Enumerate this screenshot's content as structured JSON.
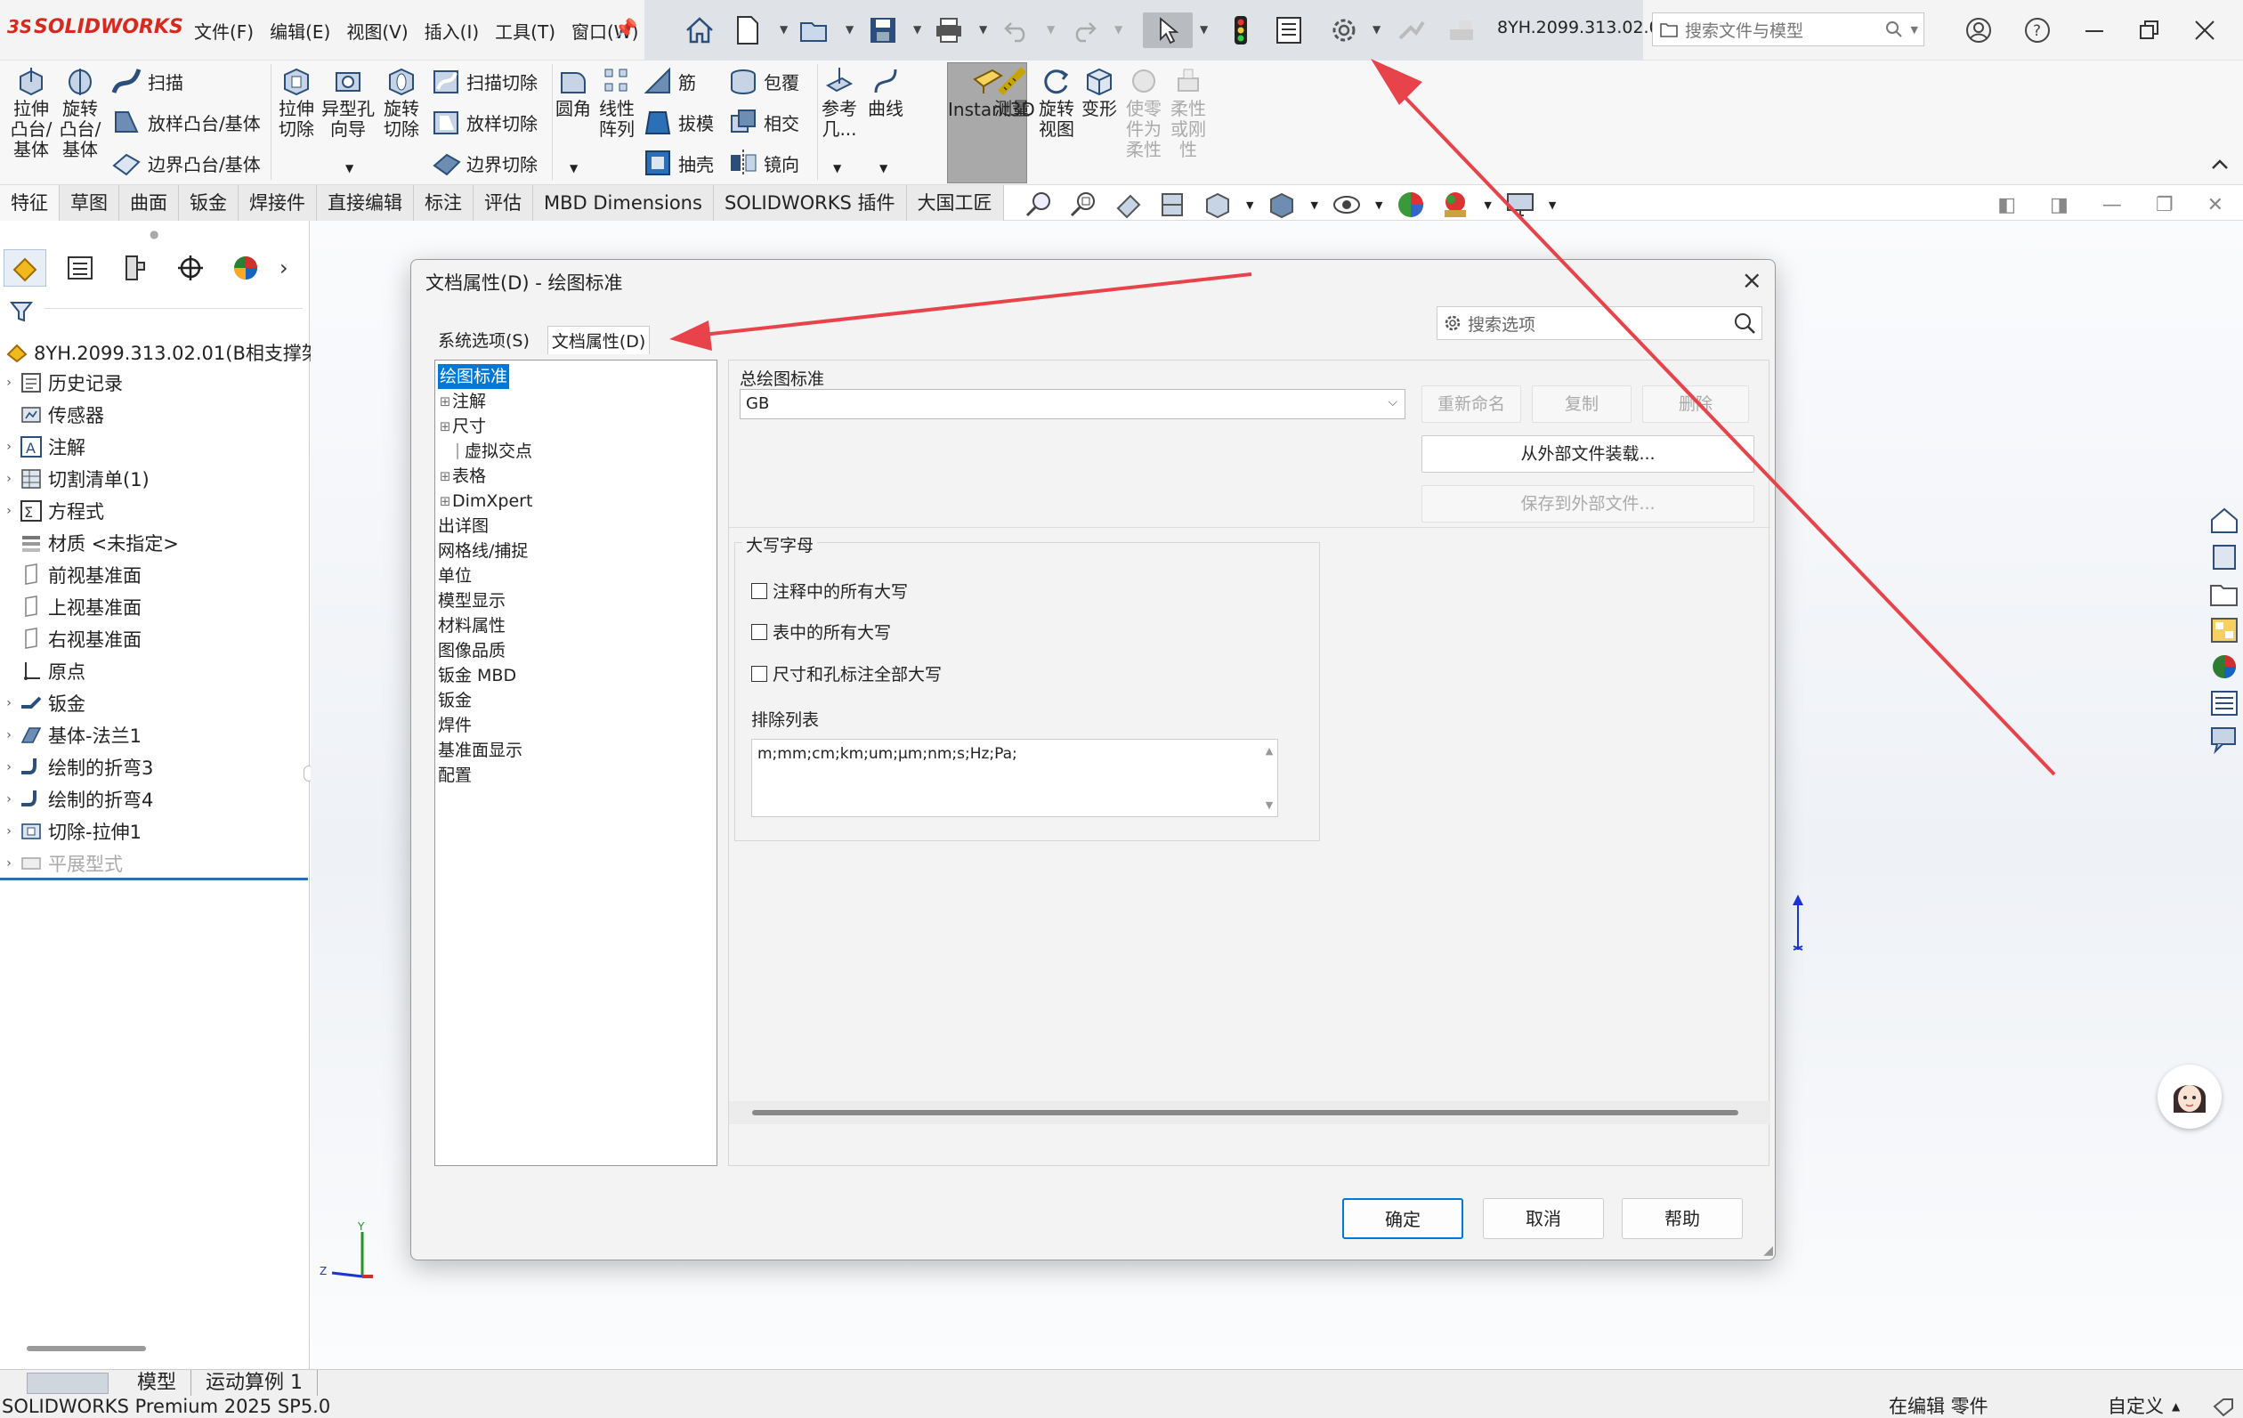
{
  "app": {
    "brand": "SOLIDWORKS",
    "menus": [
      "文件(F)",
      "编辑(E)",
      "视图(V)",
      "插入(I)",
      "工具(T)",
      "窗口(W)"
    ],
    "document_title": "8YH.2099.313.02.0...",
    "search_placeholder": "搜索文件与模型"
  },
  "command_manager": {
    "extrude_boss": "拉伸\n凸台/\n基体",
    "revolve_boss": "旋转\n凸台/\n基体",
    "sweep": "扫描",
    "loft_boss": "放样凸台/基体",
    "boundary_boss": "边界凸台/基体",
    "extrude_cut": "拉伸\n切除",
    "hole_wizard": "异型孔\n向导",
    "revolve_cut": "旋转\n切除",
    "swept_cut": "扫描切除",
    "lofted_cut": "放样切除",
    "boundary_cut": "边界切除",
    "fillet": "圆角",
    "linear_pattern": "线性\n阵列",
    "rib": "筋",
    "draft": "拔模",
    "shell": "抽壳",
    "wrap": "包覆",
    "intersect": "相交",
    "mirror": "镜向",
    "reference_geometry": "参考\n几...",
    "curves": "曲线",
    "instant3d": "Instant3D",
    "measure": "测量",
    "rotate_view": "旋转\n视图",
    "deform": "变形",
    "make_flexible": "使零\n件为\n柔性",
    "flexible_rigid": "柔性\n或刚\n性"
  },
  "tabs": [
    "特征",
    "草图",
    "曲面",
    "钣金",
    "焊接件",
    "直接编辑",
    "标注",
    "评估",
    "MBD Dimensions",
    "SOLIDWORKS 插件",
    "大国工匠"
  ],
  "feature_tree": {
    "root": "8YH.2099.313.02.01(B相支撑架",
    "items": [
      {
        "label": "历史记录",
        "expand": true,
        "icon": "history-icon"
      },
      {
        "label": "传感器",
        "expand": false,
        "icon": "sensor-icon"
      },
      {
        "label": "注解",
        "expand": true,
        "icon": "annotation-icon"
      },
      {
        "label": "切割清单(1)",
        "expand": true,
        "icon": "cutlist-icon"
      },
      {
        "label": "方程式",
        "expand": true,
        "icon": "equation-icon"
      },
      {
        "label": "材质 <未指定>",
        "expand": false,
        "icon": "material-icon"
      },
      {
        "label": "前视基准面",
        "expand": false,
        "icon": "plane-icon"
      },
      {
        "label": "上视基准面",
        "expand": false,
        "icon": "plane-icon"
      },
      {
        "label": "右视基准面",
        "expand": false,
        "icon": "plane-icon"
      },
      {
        "label": "原点",
        "expand": false,
        "icon": "origin-icon"
      },
      {
        "label": "钣金",
        "expand": true,
        "icon": "sheetmetal-icon"
      },
      {
        "label": "基体-法兰1",
        "expand": true,
        "icon": "base-flange-icon"
      },
      {
        "label": "绘制的折弯3",
        "expand": true,
        "icon": "sketched-bend-icon"
      },
      {
        "label": "绘制的折弯4",
        "expand": true,
        "icon": "sketched-bend-icon"
      },
      {
        "label": "切除-拉伸1",
        "expand": true,
        "icon": "cut-extrude-icon"
      },
      {
        "label": "平展型式",
        "expand": true,
        "icon": "flat-pattern-icon",
        "disabled": true
      }
    ]
  },
  "bottom_tabs": [
    "模型",
    "运动算例 1"
  ],
  "status": {
    "version": "SOLIDWORKS Premium 2025 SP5.0",
    "mode": "在编辑 零件",
    "custom": "自定义"
  },
  "dialog": {
    "title": "文档属性(D) - 绘图标准",
    "tabs": [
      "系统选项(S)",
      "文档属性(D)"
    ],
    "search_placeholder": "搜索选项",
    "tree": [
      {
        "label": "绘图标准",
        "selected": true,
        "level": 0,
        "expand": false
      },
      {
        "label": "注解",
        "level": 0,
        "expand": true
      },
      {
        "label": "尺寸",
        "level": 0,
        "expand": true
      },
      {
        "label": "虚拟交点",
        "level": 1,
        "expand": false
      },
      {
        "label": "表格",
        "level": 0,
        "expand": true
      },
      {
        "label": "DimXpert",
        "level": 0,
        "expand": true
      },
      {
        "label": "出详图",
        "level": 0,
        "expand": false
      },
      {
        "label": "网格线/捕捉",
        "level": 0,
        "expand": false
      },
      {
        "label": "单位",
        "level": 0,
        "expand": false
      },
      {
        "label": "模型显示",
        "level": 0,
        "expand": false
      },
      {
        "label": "材料属性",
        "level": 0,
        "expand": false
      },
      {
        "label": "图像品质",
        "level": 0,
        "expand": false
      },
      {
        "label": "钣金 MBD",
        "level": 0,
        "expand": false
      },
      {
        "label": "钣金",
        "level": 0,
        "expand": false
      },
      {
        "label": "焊件",
        "level": 0,
        "expand": false
      },
      {
        "label": "基准面显示",
        "level": 0,
        "expand": false
      },
      {
        "label": "配置",
        "level": 0,
        "expand": false
      }
    ],
    "overall_standard_label": "总绘图标准",
    "overall_standard_value": "GB",
    "rename": "重新命名",
    "copy": "复制",
    "delete": "删除",
    "load_external": "从外部文件装载...",
    "save_external": "保存到外部文件...",
    "caps_group": "大写字母",
    "caps_notes": "注释中的所有大写",
    "caps_tables": "表中的所有大写",
    "caps_dims": "尺寸和孔标注全部大写",
    "exclusion_label": "排除列表",
    "exclusion_value": "m;mm;cm;km;um;µm;nm;s;Hz;Pa;",
    "ok": "确定",
    "cancel": "取消",
    "help": "帮助"
  },
  "annotation_color": "#e8434a"
}
